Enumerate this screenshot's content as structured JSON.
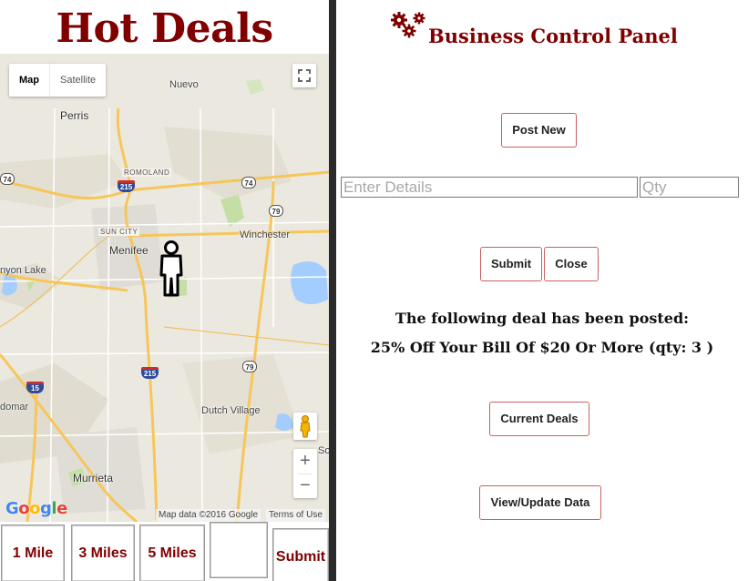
{
  "left": {
    "title": "Hot Deals",
    "map": {
      "type_tabs": [
        {
          "label": "Map",
          "selected": true
        },
        {
          "label": "Satellite",
          "selected": false
        }
      ],
      "places": [
        "Nuevo",
        "Perris",
        "ROMOLAND",
        "SUN CITY",
        "Menifee",
        "Winchester",
        "nyon Lake",
        "domar",
        "Dutch Village",
        "Murrieta",
        "So"
      ],
      "highways": [
        "74",
        "215",
        "74",
        "79",
        "215",
        "79",
        "15"
      ],
      "zoom_in": "+",
      "zoom_out": "−",
      "logo": [
        "G",
        "o",
        "o",
        "g",
        "l",
        "e"
      ],
      "logo_colors": [
        "#4285f4",
        "#ea4335",
        "#fbbc05",
        "#4285f4",
        "#34a853",
        "#ea4335"
      ],
      "map_data": "Map data ©2016 Google",
      "terms": "Terms of Use",
      "marker_icon": "person-icon",
      "fullscreen_icon": "fullscreen-icon",
      "pegman_icon": "pegman-icon"
    },
    "radius_buttons": [
      "1 Mile",
      "3 Miles",
      "5 Miles"
    ],
    "blank_button": "",
    "submit_label": "Submit"
  },
  "right": {
    "title": "Business Control Panel",
    "logo_icon": "gears-icon",
    "post_new_label": "Post New",
    "details_placeholder": "Enter Details",
    "qty_placeholder": "Qty",
    "submit_label": "Submit",
    "close_label": "Close",
    "notice_heading": "The following deal has been posted:",
    "notice_deal": "25% Off Your Bill Of $20 Or More (qty: 3 )",
    "current_deals_label": "Current Deals",
    "view_update_label": "View/Update Data"
  },
  "colors": {
    "brand": "#800000",
    "button_border": "#c9605f",
    "divider": "#2b2b2b"
  }
}
